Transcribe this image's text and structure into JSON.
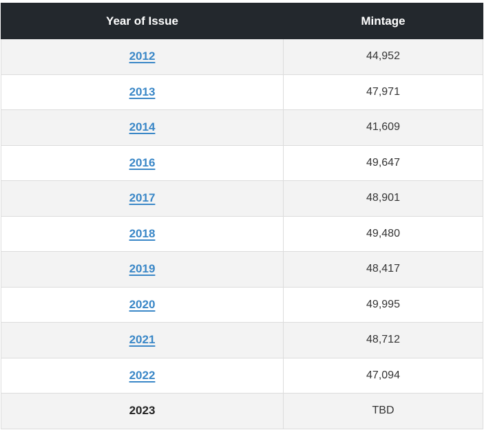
{
  "table": {
    "headers": {
      "year": "Year of Issue",
      "mintage": "Mintage"
    },
    "rows": [
      {
        "year": "2012",
        "mintage": "44,952",
        "linked": true
      },
      {
        "year": "2013",
        "mintage": "47,971",
        "linked": true
      },
      {
        "year": "2014",
        "mintage": "41,609",
        "linked": true
      },
      {
        "year": "2016",
        "mintage": "49,647",
        "linked": true
      },
      {
        "year": "2017",
        "mintage": "48,901",
        "linked": true
      },
      {
        "year": "2018",
        "mintage": "49,480",
        "linked": true
      },
      {
        "year": "2019",
        "mintage": "48,417",
        "linked": true
      },
      {
        "year": "2020",
        "mintage": "49,995",
        "linked": true
      },
      {
        "year": "2021",
        "mintage": "48,712",
        "linked": true
      },
      {
        "year": "2022",
        "mintage": "47,094",
        "linked": true
      },
      {
        "year": "2023",
        "mintage": "TBD",
        "linked": false
      }
    ]
  },
  "colors": {
    "header_bg": "#23282d",
    "link": "#3a87c7",
    "row_alt": "#f3f3f3"
  }
}
